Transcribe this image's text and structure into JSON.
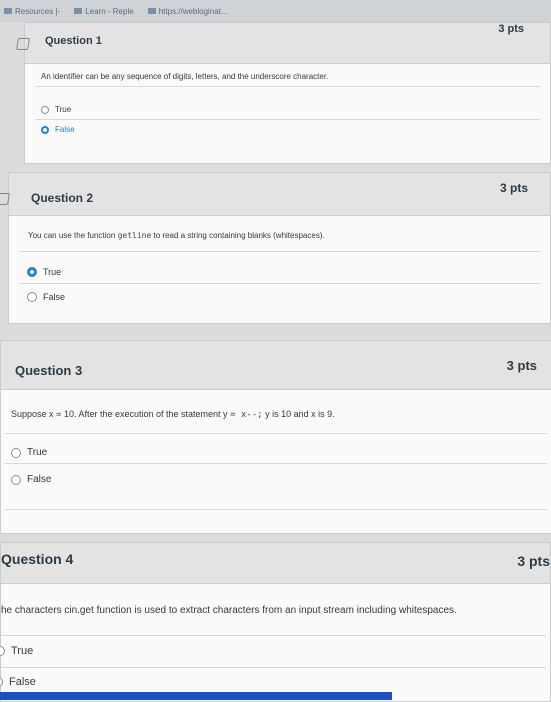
{
  "browser": {
    "bookmarks": [
      "Resources |-",
      "Learn - Reple",
      "https://webloginat..."
    ]
  },
  "questions": [
    {
      "title": "Question 1",
      "points": "3 pts",
      "text": "An identifier can be any sequence of digits, letters, and the underscore character.",
      "answers": [
        {
          "label": "True",
          "selected": false
        },
        {
          "label": "False",
          "selected": true
        }
      ]
    },
    {
      "title": "Question 2",
      "points": "3 pts",
      "text_before": "You can use the function ",
      "text_code": "getline",
      "text_after": " to read a string containing blanks (whitespaces).",
      "answers": [
        {
          "label": "True",
          "selected": true
        },
        {
          "label": "False",
          "selected": false
        }
      ]
    },
    {
      "title": "Question 3",
      "points": "3 pts",
      "text_a": "Suppose x ",
      "text_b": "=",
      "text_c": " 10. After the execution of the statement y ",
      "text_d": "=",
      "text_e": " x--;",
      "text_f": " y is 10 and x  is 9.",
      "answers": [
        {
          "label": "True",
          "selected": false
        },
        {
          "label": "False",
          "selected": false
        }
      ]
    },
    {
      "title": "Question 4",
      "points": "3 pts",
      "text": "he characters cin.get function is used to extract characters from an input stream including whitespaces.",
      "answers": [
        {
          "label": "True",
          "selected": false
        },
        {
          "label": "False",
          "selected": false
        }
      ]
    }
  ],
  "colors": {
    "accent": "#1f82d6",
    "header_bg": "#e3e3e3",
    "card_bg": "#fafafa",
    "taskbar": "#1b4fc4"
  }
}
